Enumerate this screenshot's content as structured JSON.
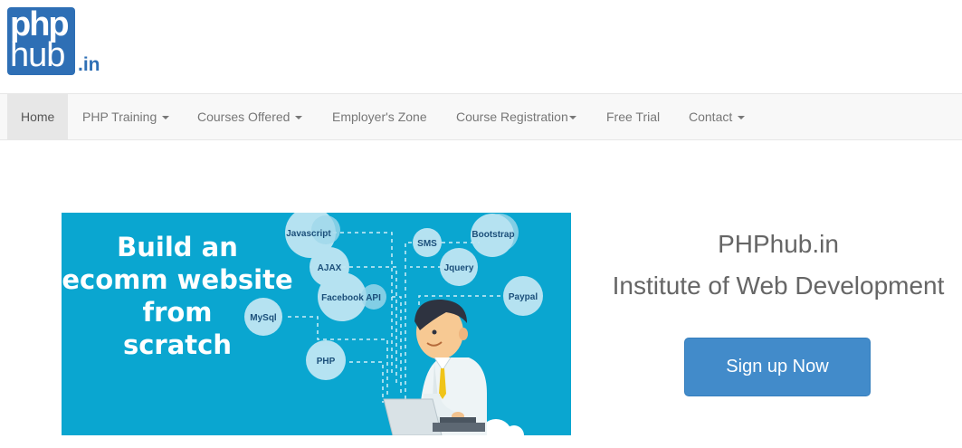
{
  "logo": {
    "top_text": "php",
    "bottom_text": "hub",
    "suffix": ".in",
    "brand_color": "#2e6fb5"
  },
  "nav": {
    "items": [
      {
        "label": "Home",
        "active": true,
        "dropdown": false
      },
      {
        "label": "PHP Training",
        "active": false,
        "dropdown": true
      },
      {
        "label": "Courses Offered",
        "active": false,
        "dropdown": true
      },
      {
        "label": "Employer's Zone",
        "active": false,
        "dropdown": false
      },
      {
        "label": "Course Registration",
        "active": false,
        "dropdown": true
      },
      {
        "label": "Free Trial",
        "active": false,
        "dropdown": false
      },
      {
        "label": "Contact",
        "active": false,
        "dropdown": true
      }
    ]
  },
  "banner": {
    "headline": [
      "Build an",
      "ecomm website",
      "from",
      "scratch"
    ],
    "bubbles": [
      "Javascript",
      "AJAX",
      "Facebook API",
      "MySql",
      "PHP",
      "SMS",
      "Bootstrap",
      "Jquery",
      "Paypal"
    ],
    "background_color": "#0aa6d0"
  },
  "hero": {
    "site_name": "PHPhub.in",
    "tagline": "Institute of Web Development",
    "signup_label": "Sign up Now",
    "button_color": "#428bca"
  }
}
